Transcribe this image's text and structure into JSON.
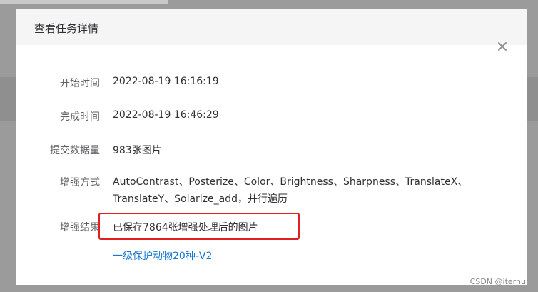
{
  "dialog": {
    "title": "查看任务详情",
    "close_icon": "close-icon"
  },
  "details": {
    "start_time": {
      "label": "开始时间",
      "value": "2022-08-19 16:16:19"
    },
    "finish_time": {
      "label": "完成时间",
      "value": "2022-08-19 16:46:29"
    },
    "submitted": {
      "label": "提交数据量",
      "value": "983张图片"
    },
    "method": {
      "label": "增强方式",
      "value": "AutoContrast、Posterize、Color、Brightness、Sharpness、TranslateX、TranslateY、Solarize_add，并行遍历"
    },
    "result": {
      "label": "增强结果",
      "value": "已保存7864张增强处理后的图片",
      "link": "一级保护动物20种-V2"
    }
  },
  "annotation": {
    "highlight_color": "#e02020"
  },
  "watermark": "CSDN @iterhui"
}
